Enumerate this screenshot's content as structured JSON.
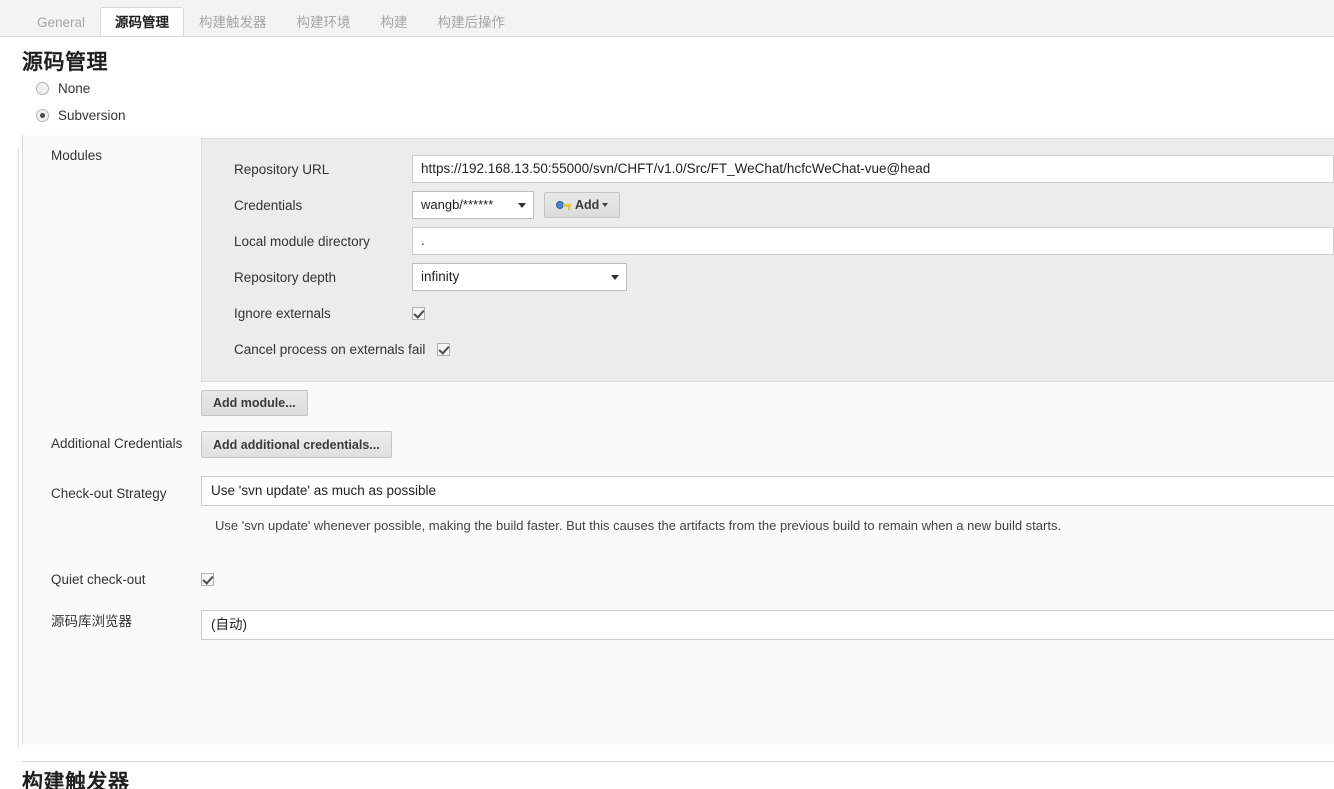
{
  "tabs": [
    {
      "label": "General",
      "active": false
    },
    {
      "label": "源码管理",
      "active": true
    },
    {
      "label": "构建触发器",
      "active": false
    },
    {
      "label": "构建环境",
      "active": false
    },
    {
      "label": "构建",
      "active": false
    },
    {
      "label": "构建后操作",
      "active": false
    }
  ],
  "section": {
    "title": "源码管理"
  },
  "scm_options": [
    {
      "label": "None",
      "checked": false
    },
    {
      "label": "Subversion",
      "checked": true
    }
  ],
  "modules": {
    "label": "Modules",
    "repository_url": {
      "label": "Repository URL",
      "value": "https://192.168.13.50:55000/svn/CHFT/v1.0/Src/FT_WeChat/hcfcWeChat-vue@head"
    },
    "credentials": {
      "label": "Credentials",
      "value": "wangb/******",
      "add_button": "Add"
    },
    "local_module_directory": {
      "label": "Local module directory",
      "value": "."
    },
    "repository_depth": {
      "label": "Repository depth",
      "value": "infinity"
    },
    "ignore_externals": {
      "label": "Ignore externals",
      "checked": true
    },
    "cancel_process_on_externals_fail": {
      "label": "Cancel process on externals fail",
      "checked": true
    },
    "add_module_button": "Add module..."
  },
  "additional_credentials": {
    "label": "Additional Credentials",
    "button": "Add additional credentials..."
  },
  "checkout_strategy": {
    "label": "Check-out Strategy",
    "value": "Use 'svn update' as much as possible",
    "description": "Use 'svn update' whenever possible, making the build faster. But this causes the artifacts from the previous build to remain when a new build starts."
  },
  "quiet_checkout": {
    "label": "Quiet check-out",
    "checked": true
  },
  "repository_browser": {
    "label": "源码库浏览器",
    "value": "(自动)"
  },
  "next_section": {
    "title": "构建触发器"
  },
  "colors": {
    "page_bg": "#ffffff",
    "tabbar_bg": "#f3f3f3",
    "panel_bg": "#fafafa",
    "modules_bg": "#ececec",
    "border": "#d9d9d9",
    "text": "#333333",
    "muted_text": "#a6a6a6",
    "key_blue": "#4b86c8",
    "key_yellow": "#e8c33c"
  }
}
